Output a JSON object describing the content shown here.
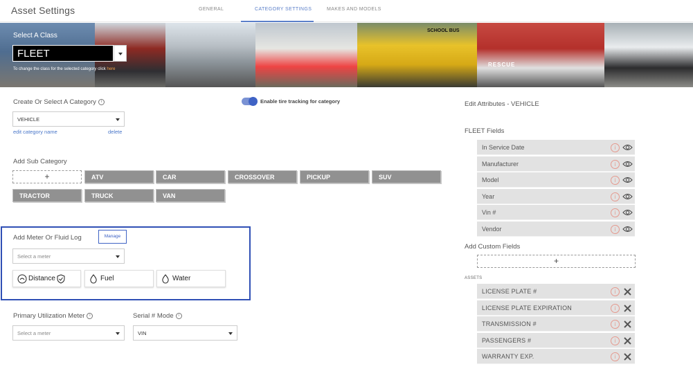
{
  "header": {
    "title": "Asset Settings",
    "tabs": [
      {
        "label": "GENERAL",
        "active": false
      },
      {
        "label": "CATEGORY SETTINGS",
        "active": true
      },
      {
        "label": "MAKES AND MODELS",
        "active": false
      }
    ],
    "accent_color": "#5b7fc9"
  },
  "banner": {
    "select_class_label": "Select A Class",
    "selected_class": "FLEET",
    "hint_prefix": "To change the class for the selected category click ",
    "hint_link": "here",
    "bus_text": "SCHOOL BUS",
    "rescue_text": "RESCUE"
  },
  "category": {
    "label": "Create Or Select A Category",
    "selected": "VEHICLE",
    "edit_link": "edit category name",
    "delete_link": "delete"
  },
  "tire_tracking": {
    "label": "Enable tire tracking for category",
    "enabled": true
  },
  "subcategory": {
    "label": "Add Sub Category",
    "add_symbol": "+",
    "items": [
      "ATV",
      "CAR",
      "CROSSOVER",
      "PICKUP",
      "SUV",
      "TRACTOR",
      "TRUCK",
      "VAN"
    ]
  },
  "meter": {
    "label": "Add Meter Or Fluid Log",
    "manage_label": "Manage",
    "select_placeholder": "Select a meter",
    "cards": [
      {
        "label": "Distance",
        "icon": "speedometer-shield-icon"
      },
      {
        "label": "Fuel",
        "icon": "drop-icon"
      },
      {
        "label": "Water",
        "icon": "drop-icon"
      }
    ],
    "highlight_color": "#2f4fb5"
  },
  "utilization": {
    "label": "Primary Utilization Meter",
    "placeholder": "Select a meter"
  },
  "serial": {
    "label": "Serial # Mode",
    "value": "VIN"
  },
  "attributes": {
    "title": "Edit Attributes - VEHICLE",
    "fleet_fields_label": "FLEET Fields",
    "fleet_fields": [
      "In Service Date",
      "Manufacturer",
      "Model",
      "Year",
      "Vin #",
      "Vendor"
    ],
    "custom_fields_label": "Add Custom Fields",
    "add_symbol": "+",
    "assets_label": "ASSETS",
    "asset_fields": [
      "LICENSE PLATE #",
      "LICENSE PLATE EXPIRATION",
      "TRANSMISSION #",
      "PASSENGERS #",
      "WARRANTY EXP."
    ]
  }
}
